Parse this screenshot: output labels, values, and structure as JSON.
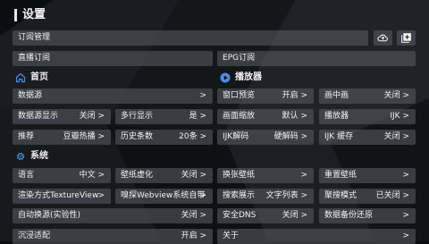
{
  "page": {
    "title": "设置"
  },
  "top": {
    "subscription": "订阅管理",
    "live": "直播订阅",
    "epg": "EPG订阅",
    "cloud_icon": "cloud-upload-icon",
    "add_icon": "add-box-icon"
  },
  "sections": {
    "home": "首页",
    "player": "播放器",
    "system": "系统"
  },
  "home": {
    "datasource": {
      "label": "数据源",
      "value": ">"
    },
    "datasource_display": {
      "label": "数据源显示",
      "value": "关闭 >"
    },
    "multirow": {
      "label": "多行显示",
      "value": "是 >"
    },
    "recommend": {
      "label": "推荐",
      "value": "豆瓣热播 >"
    },
    "history": {
      "label": "历史条数",
      "value": "20条 >"
    }
  },
  "player": {
    "window_preview": {
      "label": "窗口预览",
      "value": "开启 >"
    },
    "pip": {
      "label": "画中画",
      "value": "关闭 >"
    },
    "scale": {
      "label": "画面缩放",
      "value": "默认 >"
    },
    "player": {
      "label": "播放器",
      "value": "IJK >"
    },
    "ijk_decode": {
      "label": "IJK解码",
      "value": "硬解码 >"
    },
    "ijk_cache": {
      "label": "IJK 缓存",
      "value": "关闭 >"
    }
  },
  "system": {
    "language": {
      "label": "语言",
      "value": "中文 >"
    },
    "wallpaper_blur": {
      "label": "壁纸虚化",
      "value": "关闭 >"
    },
    "change_wallpaper": {
      "label": "换张壁纸",
      "value": ">"
    },
    "reset_wallpaper": {
      "label": "重置壁纸",
      "value": ">"
    },
    "render": {
      "label": "渲染方式TextureView",
      "value": ">"
    },
    "sniff": {
      "label": "嗅探Webview系统自带",
      "value": ">"
    },
    "search_display": {
      "label": "搜索展示",
      "value": "文字列表 >"
    },
    "aggregate": {
      "label": "聚搜模式",
      "value": "已关闭 >"
    },
    "auto_switch": {
      "label": "自动换源(实验性)",
      "value": "关闭 >"
    },
    "secure_dns": {
      "label": "安全DNS",
      "value": "关闭 >"
    },
    "backup": {
      "label": "数据备份还原",
      "value": ">"
    },
    "immersive": {
      "label": "沉浸适配",
      "value": "开启 >"
    },
    "about": {
      "label": "关于",
      "value": ">"
    }
  },
  "colors": {
    "accent": "#4a8fe0",
    "row_bg": "#50535a",
    "background": "#0c0d10"
  }
}
